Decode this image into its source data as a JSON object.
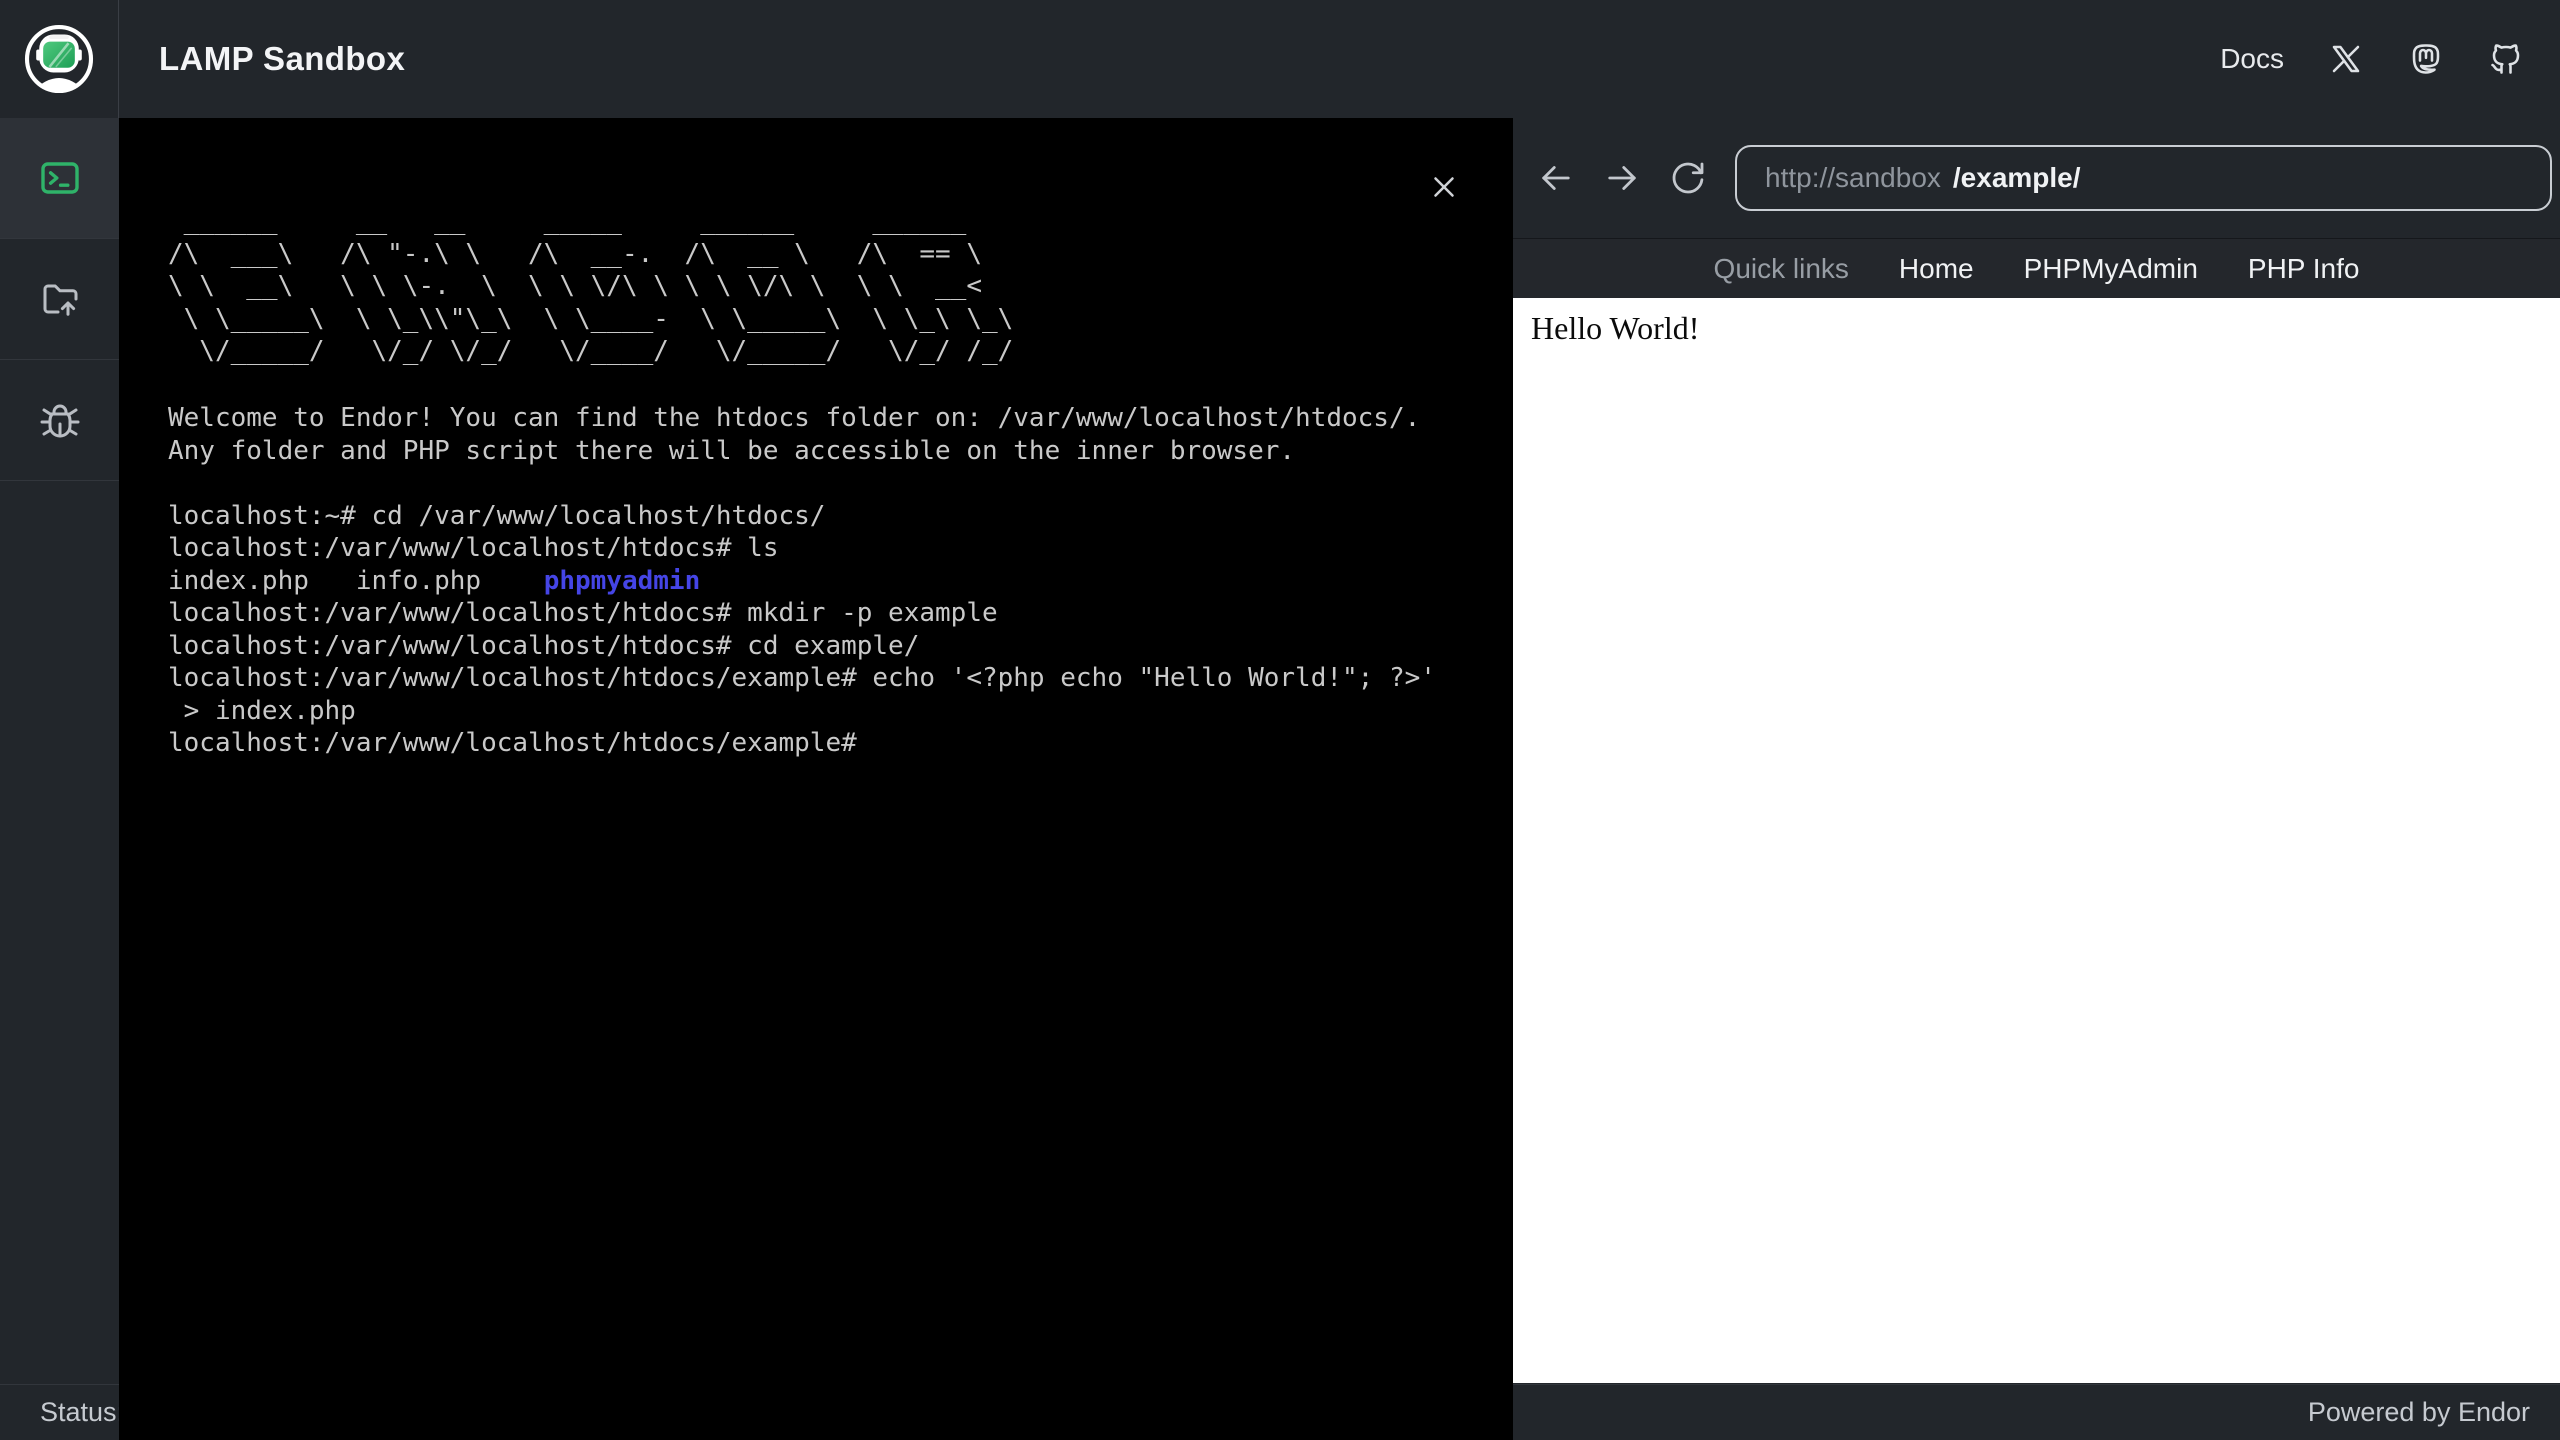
{
  "header": {
    "title": "LAMP Sandbox",
    "docs_label": "Docs",
    "social_icons": [
      "x-twitter",
      "mastodon",
      "github"
    ]
  },
  "sidebar": {
    "items": [
      {
        "id": "terminal",
        "active": true
      },
      {
        "id": "folder-upload",
        "active": false
      },
      {
        "id": "debug",
        "active": false
      }
    ]
  },
  "terminal": {
    "ascii_art": [
      " ______     __   __     _____     ______     ______    ",
      "/\\  ___\\   /\\ \"-.\\ \\   /\\  __-.  /\\  __ \\   /\\  == \\   ",
      "\\ \\  __\\   \\ \\ \\-.  \\  \\ \\ \\/\\ \\ \\ \\ \\/\\ \\  \\ \\  __<   ",
      " \\ \\_____\\  \\ \\_\\\\\"\\_\\  \\ \\____-  \\ \\_____\\  \\ \\_\\ \\_\\ ",
      "  \\/_____/   \\/_/ \\/_/   \\/____/   \\/_____/   \\/_/ /_/ "
    ],
    "lines": [
      [
        {
          "t": "Welcome to Endor! You can find the htdocs folder on: /var/www/localhost/htdocs/.",
          "c": "fg"
        }
      ],
      [
        {
          "t": "Any folder and PHP script there will be accessible on the inner browser.",
          "c": "fg"
        }
      ],
      [],
      [
        {
          "t": "localhost:~# cd /var/www/localhost/htdocs/",
          "c": "fg"
        }
      ],
      [
        {
          "t": "localhost:/var/www/localhost/htdocs# ls",
          "c": "fg"
        }
      ],
      [
        {
          "t": "index.php   info.php    ",
          "c": "fg"
        },
        {
          "t": "phpmyadmin",
          "c": "dir"
        }
      ],
      [
        {
          "t": "localhost:/var/www/localhost/htdocs# mkdir -p example",
          "c": "fg"
        }
      ],
      [
        {
          "t": "localhost:/var/www/localhost/htdocs# cd example/",
          "c": "fg"
        }
      ],
      [
        {
          "t": "localhost:/var/www/localhost/htdocs/example# echo '<?php echo \"Hello World!\"; ?>'",
          "c": "fg"
        }
      ],
      [
        {
          "t": " > index.php",
          "c": "fg"
        }
      ],
      [
        {
          "t": "localhost:/var/www/localhost/htdocs/example#",
          "c": "fg"
        }
      ]
    ]
  },
  "browser": {
    "url_host": "http://sandbox",
    "url_path": "/example/",
    "quick_links_label": "Quick links",
    "links": [
      "Home",
      "PHPMyAdmin",
      "PHP Info"
    ],
    "content": "Hello World!"
  },
  "statusbar": {
    "left": "Status:",
    "right": "Powered by Endor"
  },
  "colors": {
    "chrome_bg": "#22262b",
    "accent_green": "#2fb369",
    "terminal_bg": "#000000",
    "terminal_fg": "#c9c9c9",
    "directory_blue": "#4545e6",
    "content_bg": "#ffffff"
  }
}
